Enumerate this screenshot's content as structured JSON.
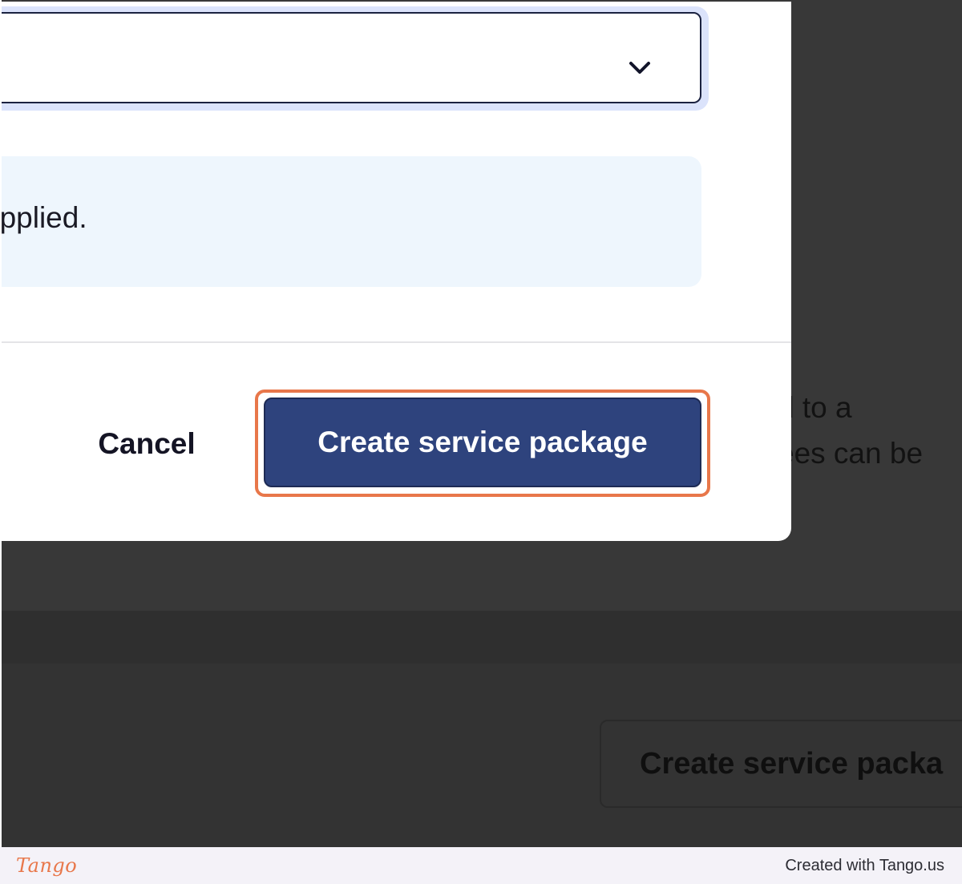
{
  "background": {
    "text_lines": [
      "d to a",
      "ees can be"
    ],
    "button_label": "Create service packa"
  },
  "modal": {
    "select": {
      "value": "",
      "icon": "chevron-down-icon"
    },
    "info": {
      "text": "is applied."
    },
    "footer": {
      "cancel_label": "Cancel",
      "primary_label": "Create service package"
    }
  },
  "tango_footer": {
    "logo_text": "Tango",
    "credit": "Created with Tango.us"
  },
  "colors": {
    "primary": "#2e437d",
    "highlight": "#e8774a",
    "info_bg": "#eef6fd",
    "overlay": "#383838"
  }
}
